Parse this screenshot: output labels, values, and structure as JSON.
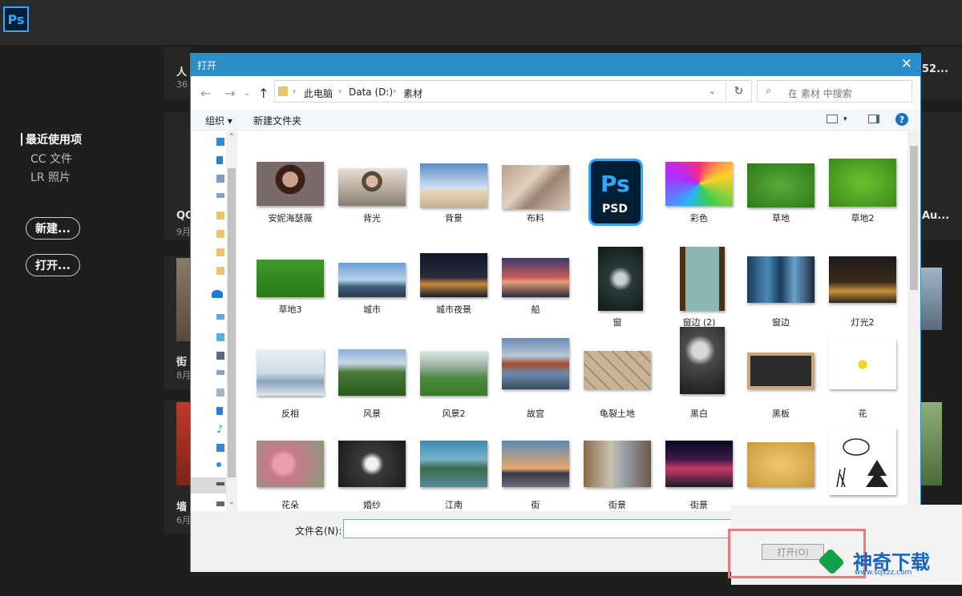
{
  "ps": {
    "logo": "Ps",
    "nav": [
      "最近使用项",
      "CC 文件",
      "LR 照片"
    ],
    "new_btn": "新建...",
    "open_btn": "打开...",
    "recent_cards": [
      {
        "title": "人",
        "sub": "36"
      },
      {
        "title": "QQ",
        "sub": "9月"
      },
      {
        "title": "街",
        "sub": "8月"
      },
      {
        "title": "墙",
        "sub": "6月"
      }
    ],
    "right_labels": [
      "52...",
      "Au..."
    ]
  },
  "dialog": {
    "title": "打开",
    "close": "✕",
    "path": [
      "此电脑",
      "Data (D:)",
      "素材"
    ],
    "search_placeholder": "在 素材 中搜索",
    "toolbar": {
      "organize": "组织",
      "new_folder": "新建文件夹"
    },
    "filename_label": "文件名(N):",
    "filename_value": "",
    "open_button": "打开(O)",
    "files": [
      "安妮海瑟薇",
      "背光",
      "背景",
      "布料",
      "布料",
      "彩色",
      "草地",
      "草地2",
      "草地3",
      "城市",
      "城市夜景",
      "船",
      "窗",
      "窗边 (2)",
      "窗边",
      "灯光2",
      "反相",
      "风景",
      "风景2",
      "故宫",
      "龟裂土地",
      "黑白",
      "黑板",
      "花",
      "花朵",
      "婚纱",
      "江南",
      "街",
      "街景",
      "街景",
      "",
      ""
    ]
  },
  "watermark": {
    "name": "神奇下载",
    "url": "www.sqxzz.com"
  }
}
